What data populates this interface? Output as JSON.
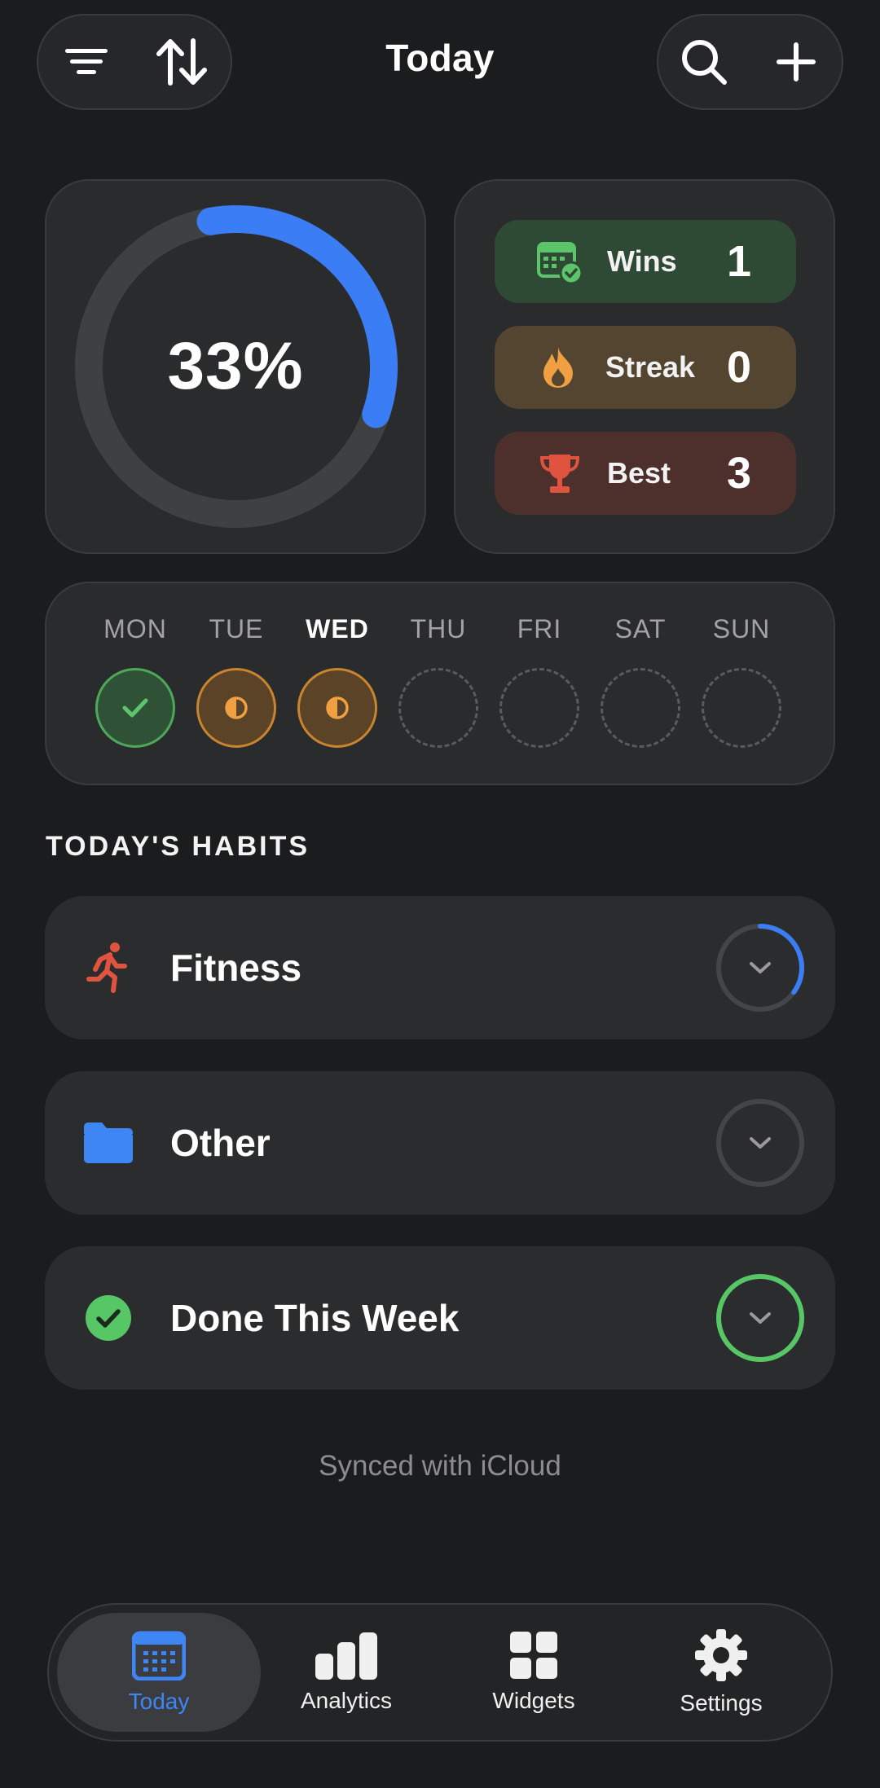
{
  "header": {
    "title": "Today",
    "left_icons": [
      "filter-icon",
      "sort-icon"
    ],
    "right_icons": [
      "search-icon",
      "add-icon"
    ]
  },
  "progress": {
    "label": "33%",
    "fraction": 0.33,
    "color": "#3a7df5"
  },
  "stats": {
    "wins": {
      "label": "Wins",
      "value": "1",
      "icon": "calendar-check-icon"
    },
    "streak": {
      "label": "Streak",
      "value": "0",
      "icon": "flame-icon"
    },
    "best": {
      "label": "Best",
      "value": "3",
      "icon": "trophy-icon"
    }
  },
  "week": {
    "days": [
      {
        "label": "MON",
        "state": "done",
        "current": false
      },
      {
        "label": "TUE",
        "state": "partial",
        "current": false
      },
      {
        "label": "WED",
        "state": "partial",
        "current": true
      },
      {
        "label": "THU",
        "state": "empty",
        "current": false
      },
      {
        "label": "FRI",
        "state": "empty",
        "current": false
      },
      {
        "label": "SAT",
        "state": "empty",
        "current": false
      },
      {
        "label": "SUN",
        "state": "empty",
        "current": false
      }
    ]
  },
  "habits": {
    "section_title": "TODAY'S HABITS",
    "groups": [
      {
        "label": "Fitness",
        "icon": "running-person-icon",
        "progress": 0.35,
        "ring_color": "#3a7df5"
      },
      {
        "label": "Other",
        "icon": "folder-icon",
        "progress": 0,
        "ring_color": "#3a7df5"
      },
      {
        "label": "Done This Week",
        "icon": "check-circle-icon",
        "progress": 1,
        "ring_color": "#57c766"
      }
    ]
  },
  "footer": {
    "sync_status": "Synced with iCloud"
  },
  "tabs": [
    {
      "label": "Today",
      "icon": "calendar-icon",
      "active": true
    },
    {
      "label": "Analytics",
      "icon": "bar-chart-icon",
      "active": false
    },
    {
      "label": "Widgets",
      "icon": "widgets-grid-icon",
      "active": false
    },
    {
      "label": "Settings",
      "icon": "gear-icon",
      "active": false
    }
  ],
  "colors": {
    "background": "#1b1c1d",
    "accent_blue": "#3a7df5",
    "success_green": "#57c766",
    "warning_orange": "#e79a3a",
    "danger_red": "#e0533e"
  }
}
